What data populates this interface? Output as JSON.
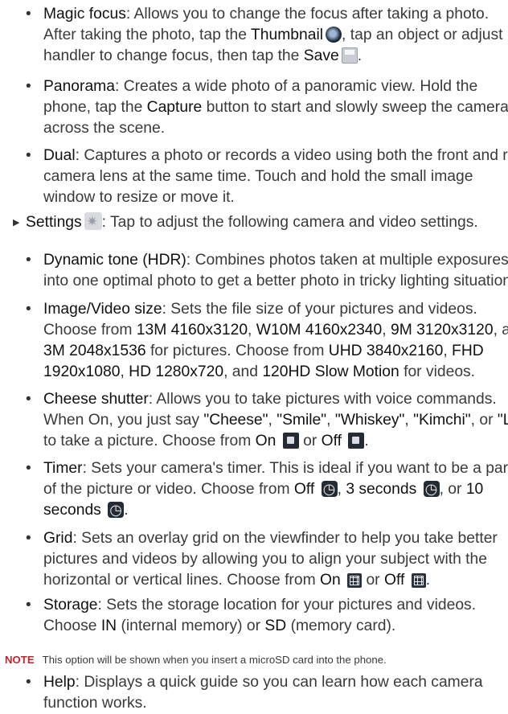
{
  "magic_focus": {
    "title": "Magic focus",
    "lines": [
      "Allows you to change the focus after taking a photo.",
      "After taking the photo, tap the",
      "handler to change focus, then tap the"
    ],
    "thumbnail": "Thumbnail",
    "thumb_tail": ", tap an object or adjust",
    "save": "Save",
    "icons": [
      "thumbnail-icon",
      "save-icon"
    ]
  },
  "panorama": {
    "title": "Panorama",
    "lines": [
      "Creates a wide photo of a panoramic view. Hold the",
      "phone, tap the",
      "button to start and slowly sweep the camera",
      "across the scene."
    ],
    "capture": "Capture"
  },
  "dual": {
    "title": "Dual",
    "lines": [
      "Captures a photo or records a video using both the front and rear",
      "camera lens at the same time. Touch and hold the small image",
      "window to resize or move it."
    ]
  },
  "settings": {
    "title": "Settings",
    "desc": "Tap to adjust the following camera and video settings.",
    "icon": "settings-gear-icon"
  },
  "dynamic_tone": {
    "title": "Dynamic tone (HDR)",
    "lines": [
      "Combines photos taken at multiple exposures",
      "into one optimal photo to get a better photo in tricky lighting situations."
    ]
  },
  "image_size": {
    "title": "Image/Video size",
    "line1": "Sets the file size of your pictures and videos.",
    "choose": "Choose from",
    "pic_opts": [
      "13M 4160x3120",
      "W10M 4160x2340",
      "9M 3120x3120",
      "3M 2048x1536"
    ],
    "for_pictures": "for pictures. Choose from",
    "vid_opts": [
      "UHD 3840x2160",
      "FHD",
      "1920x1080",
      "HD 1280x720",
      "120HD Slow Motion"
    ],
    "for_videos": "for videos.",
    "and": "and"
  },
  "cheese": {
    "title": "Cheese shutter",
    "line1": "Allows you to take pictures with voice commands.",
    "line2_pre": "When On, you just say",
    "words": [
      "\"Cheese\"",
      "\"Smile\"",
      "\"Whiskey\"",
      "\"Kimchi\"",
      "\"LG\""
    ],
    "or": "or",
    "line3_pre": "to take a picture. Choose from",
    "on": "On",
    "off": "Off"
  },
  "timer": {
    "title": "Timer",
    "line1": "Sets your camera's timer. This is ideal if you want to be a part",
    "line2": "of the picture or video. Choose from",
    "off": "Off",
    "three": "3 seconds",
    "or": ", or",
    "ten_a": "10",
    "ten_b": "seconds"
  },
  "grid": {
    "title": "Grid",
    "lines": [
      "Sets an overlay grid on the viewfinder to help you take better",
      "pictures and videos by allowing you to align your subject with the",
      "horizontal or vertical lines. Choose from"
    ],
    "on": "On",
    "off": "Off",
    "or": "or"
  },
  "storage": {
    "title": "Storage",
    "line1": "Sets the storage location for your pictures and videos.",
    "choose": "Choose",
    "in": "IN",
    "in_desc": "(internal memory) or",
    "sd": "SD",
    "sd_desc": "(memory card)."
  },
  "note": {
    "label": "NOTE",
    "text": "This option will be shown when you insert a microSD card into the phone."
  },
  "help": {
    "title": "Help",
    "lines": [
      "Displays a quick guide so you can learn how each camera",
      "function works."
    ]
  }
}
